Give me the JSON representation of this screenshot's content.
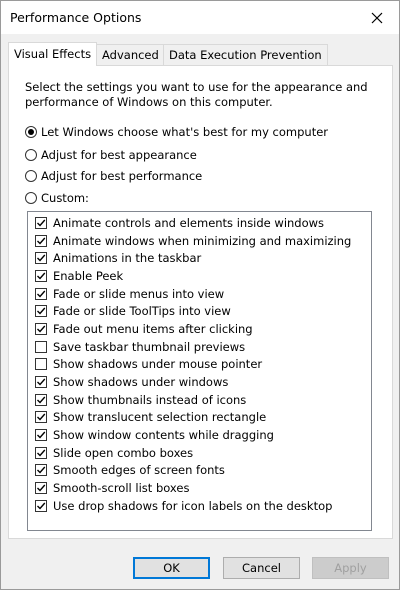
{
  "window": {
    "title": "Performance Options"
  },
  "tabs": [
    "Visual Effects",
    "Advanced",
    "Data Execution Prevention"
  ],
  "description": "Select the settings you want to use for the appearance and performance of Windows on this computer.",
  "radios": [
    {
      "label": "Let Windows choose what's best for my computer",
      "checked": true
    },
    {
      "label": "Adjust for best appearance",
      "checked": false
    },
    {
      "label": "Adjust for best performance",
      "checked": false
    },
    {
      "label": "Custom:",
      "checked": false
    }
  ],
  "effects": [
    {
      "label": "Animate controls and elements inside windows",
      "checked": true
    },
    {
      "label": "Animate windows when minimizing and maximizing",
      "checked": true
    },
    {
      "label": "Animations in the taskbar",
      "checked": true
    },
    {
      "label": "Enable Peek",
      "checked": true
    },
    {
      "label": "Fade or slide menus into view",
      "checked": true
    },
    {
      "label": "Fade or slide ToolTips into view",
      "checked": true
    },
    {
      "label": "Fade out menu items after clicking",
      "checked": true
    },
    {
      "label": "Save taskbar thumbnail previews",
      "checked": false
    },
    {
      "label": "Show shadows under mouse pointer",
      "checked": false
    },
    {
      "label": "Show shadows under windows",
      "checked": true
    },
    {
      "label": "Show thumbnails instead of icons",
      "checked": true
    },
    {
      "label": "Show translucent selection rectangle",
      "checked": true
    },
    {
      "label": "Show window contents while dragging",
      "checked": true
    },
    {
      "label": "Slide open combo boxes",
      "checked": true
    },
    {
      "label": "Smooth edges of screen fonts",
      "checked": true
    },
    {
      "label": "Smooth-scroll list boxes",
      "checked": true
    },
    {
      "label": "Use drop shadows for icon labels on the desktop",
      "checked": true
    }
  ],
  "buttons": {
    "ok": "OK",
    "cancel": "Cancel",
    "apply": "Apply"
  }
}
